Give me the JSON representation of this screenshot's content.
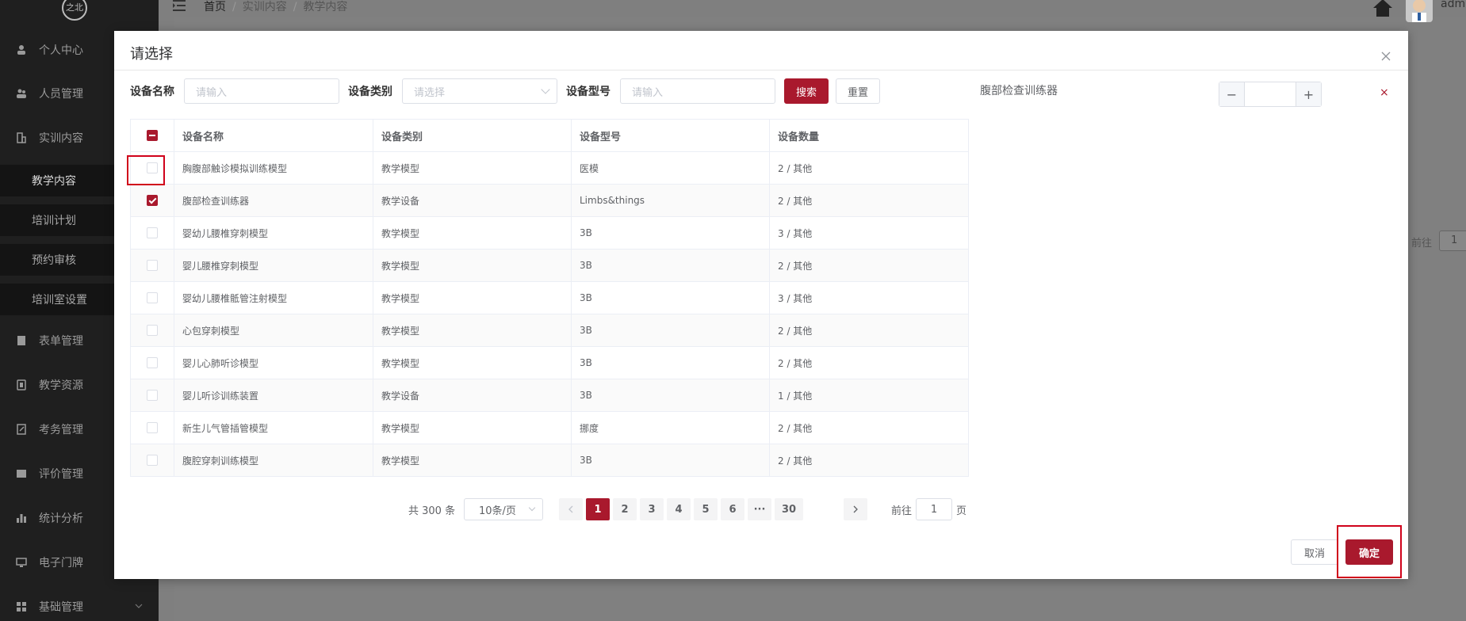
{
  "sidebar": {
    "logo": "之北",
    "items": [
      {
        "label": "个人中心",
        "icon": "user-icon"
      },
      {
        "label": "人员管理",
        "icon": "users-icon"
      },
      {
        "label": "实训内容",
        "icon": "book-icon"
      },
      {
        "label": "表单管理",
        "icon": "form-icon"
      },
      {
        "label": "教学资源",
        "icon": "resource-icon"
      },
      {
        "label": "考务管理",
        "icon": "exam-icon"
      },
      {
        "label": "评价管理",
        "icon": "evaluate-icon"
      },
      {
        "label": "统计分析",
        "icon": "chart-icon"
      },
      {
        "label": "电子门牌",
        "icon": "monitor-icon"
      },
      {
        "label": "基础管理",
        "icon": "grid-icon"
      }
    ],
    "subitems": [
      "教学内容",
      "培训计划",
      "预约审核",
      "培训室设置"
    ]
  },
  "breadcrumb": [
    "首页",
    "实训内容",
    "教学内容"
  ],
  "header": {
    "user": "admi"
  },
  "background": {
    "jump_label": "前往",
    "jump_value": "1"
  },
  "dialog": {
    "title": "请选择",
    "filters": {
      "name_label": "设备名称",
      "name_placeholder": "请输入",
      "type_label": "设备类别",
      "type_placeholder": "请选择",
      "model_label": "设备型号",
      "model_placeholder": "请输入",
      "search_label": "搜索",
      "reset_label": "重置"
    },
    "table": {
      "columns": [
        "设备名称",
        "设备类别",
        "设备型号",
        "设备数量"
      ],
      "rows": [
        {
          "name": "胸腹部触诊模拟训练模型",
          "type": "教学模型",
          "model": "医模",
          "qty": "2 / 其他",
          "checked": false
        },
        {
          "name": "腹部检查训练器",
          "type": "教学设备",
          "model": "Limbs&things",
          "qty": "2 / 其他",
          "checked": true
        },
        {
          "name": "婴幼儿腰椎穿刺模型",
          "type": "教学模型",
          "model": "3B",
          "qty": "3 / 其他",
          "checked": false
        },
        {
          "name": "婴儿腰椎穿刺模型",
          "type": "教学模型",
          "model": "3B",
          "qty": "2 / 其他",
          "checked": false
        },
        {
          "name": "婴幼儿腰椎骶管注射模型",
          "type": "教学模型",
          "model": "3B",
          "qty": "3 / 其他",
          "checked": false
        },
        {
          "name": "心包穿刺模型",
          "type": "教学模型",
          "model": "3B",
          "qty": "2 / 其他",
          "checked": false
        },
        {
          "name": "婴儿心肺听诊模型",
          "type": "教学模型",
          "model": "3B",
          "qty": "2 / 其他",
          "checked": false
        },
        {
          "name": "婴儿听诊训练装置",
          "type": "教学设备",
          "model": "3B",
          "qty": "1 / 其他",
          "checked": false
        },
        {
          "name": "新生儿气管插管模型",
          "type": "教学模型",
          "model": "挪度",
          "qty": "2 / 其他",
          "checked": false
        },
        {
          "name": "腹腔穿刺训练模型",
          "type": "教学模型",
          "model": "3B",
          "qty": "2 / 其他",
          "checked": false
        }
      ]
    },
    "pagination": {
      "total": "共 300 条",
      "page_size": "10条/页",
      "pages": [
        "1",
        "2",
        "3",
        "4",
        "5",
        "6",
        "···",
        "30"
      ],
      "current": "1",
      "jump_prefix": "前往",
      "jump_value": "1",
      "jump_suffix": "页"
    },
    "selected": {
      "name": "腹部检查训练器",
      "quantity": "",
      "remove": "×"
    },
    "footer": {
      "cancel_label": "取消",
      "confirm_label": "确定"
    }
  },
  "colors": {
    "primary": "#a9192d",
    "highlight": "#d0021b"
  }
}
